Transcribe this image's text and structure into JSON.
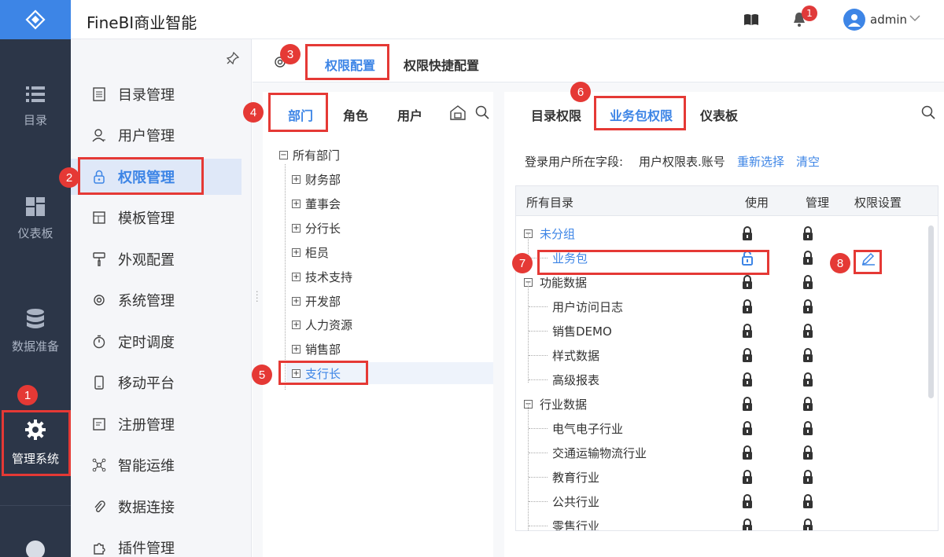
{
  "app": {
    "title": "FineBI商业智能"
  },
  "header": {
    "notifications_count": "1",
    "username": "admin"
  },
  "leftnav": {
    "items": [
      {
        "label": "目录",
        "icon": "list-icon"
      },
      {
        "label": "仪表板",
        "icon": "dashboard-icon"
      },
      {
        "label": "数据准备",
        "icon": "database-icon"
      },
      {
        "label": "管理系统",
        "icon": "gear-icon",
        "active": true
      }
    ]
  },
  "sidebar": {
    "items": [
      {
        "label": "目录管理",
        "icon": "catalog-icon"
      },
      {
        "label": "用户管理",
        "icon": "user-icon"
      },
      {
        "label": "权限管理",
        "icon": "lock-icon",
        "active": true
      },
      {
        "label": "模板管理",
        "icon": "template-icon"
      },
      {
        "label": "外观配置",
        "icon": "brush-icon"
      },
      {
        "label": "系统管理",
        "icon": "settings-icon"
      },
      {
        "label": "定时调度",
        "icon": "timer-icon"
      },
      {
        "label": "移动平台",
        "icon": "mobile-icon"
      },
      {
        "label": "注册管理",
        "icon": "register-icon"
      },
      {
        "label": "智能运维",
        "icon": "ops-icon"
      },
      {
        "label": "数据连接",
        "icon": "link-icon"
      },
      {
        "label": "插件管理",
        "icon": "plugin-icon"
      }
    ]
  },
  "tabs": {
    "permission_config": "权限配置",
    "permission_quick": "权限快捷配置"
  },
  "left_panel": {
    "tabs": {
      "dept": "部门",
      "role": "角色",
      "user": "用户"
    },
    "tree_root": "所有部门",
    "tree_items": [
      "财务部",
      "董事会",
      "分行长",
      "柜员",
      "技术支持",
      "开发部",
      "人力资源",
      "销售部",
      "支行长"
    ],
    "selected": "支行长"
  },
  "right_panel": {
    "tabs": {
      "catalog": "目录权限",
      "package": "业务包权限",
      "dashboard": "仪表板"
    },
    "field_label": "登录用户所在字段:",
    "field_value": "用户权限表.账号",
    "reselect": "重新选择",
    "clear": "清空",
    "columns": {
      "name": "所有目录",
      "use": "使用",
      "manage": "管理",
      "setting": "权限设置"
    },
    "rows": [
      {
        "name": "未分组",
        "group": true,
        "link": true
      },
      {
        "name": "业务包",
        "group": false,
        "link": true,
        "use_unlocked": true,
        "editable": true
      },
      {
        "name": "功能数据",
        "group": true
      },
      {
        "name": "用户访问日志",
        "group": false
      },
      {
        "name": "销售DEMO",
        "group": false
      },
      {
        "name": "样式数据",
        "group": false
      },
      {
        "name": "高级报表",
        "group": false
      },
      {
        "name": "行业数据",
        "group": true
      },
      {
        "name": "电气电子行业",
        "group": false
      },
      {
        "name": "交通运输物流行业",
        "group": false
      },
      {
        "name": "教育行业",
        "group": false
      },
      {
        "name": "公共行业",
        "group": false
      },
      {
        "name": "零售行业",
        "group": false
      }
    ]
  },
  "annotations": [
    "1",
    "2",
    "3",
    "4",
    "5",
    "6",
    "7",
    "8"
  ],
  "colors": {
    "accent": "#3d85e6",
    "nav_bg": "#2c3648",
    "annotation": "#e53935"
  }
}
